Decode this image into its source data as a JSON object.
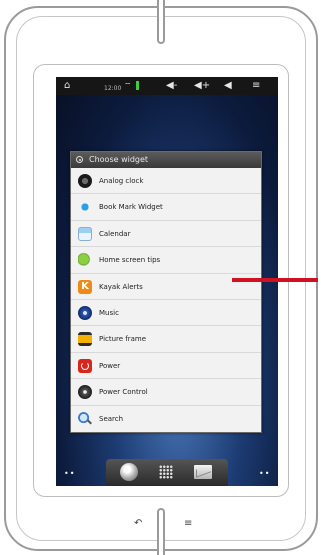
{
  "status_bar": {
    "home_icon": "home-icon",
    "time": "12:00",
    "wifi_icon": "wifi-icon",
    "icons": [
      "volume-down-icon",
      "volume-up-icon",
      "back-icon",
      "menu-icon"
    ]
  },
  "dialog": {
    "title": "Choose widget",
    "items": [
      {
        "label": "Analog clock",
        "icon": "analog-clock-icon"
      },
      {
        "label": "Book Mark Widget",
        "icon": "bookmark-icon"
      },
      {
        "label": "Calendar",
        "icon": "calendar-icon"
      },
      {
        "label": "Home screen tips",
        "icon": "home-screen-tips-icon"
      },
      {
        "label": "Kayak Alerts",
        "icon": "kayak-icon",
        "glyph": "K"
      },
      {
        "label": "Music",
        "icon": "music-icon"
      },
      {
        "label": "Picture frame",
        "icon": "picture-frame-icon"
      },
      {
        "label": "Power",
        "icon": "power-icon"
      },
      {
        "label": "Power Control",
        "icon": "power-control-icon"
      },
      {
        "label": "Search",
        "icon": "search-icon"
      }
    ]
  },
  "dock": {
    "left_dots": "••",
    "right_dots": "••",
    "buttons": [
      "browser-icon",
      "apps-grid-icon",
      "mail-icon"
    ]
  },
  "colors": {
    "pointer": "#d0111f",
    "battery": "#3fcc3f",
    "kayak": "#f08a14",
    "power": "#d9261c"
  }
}
